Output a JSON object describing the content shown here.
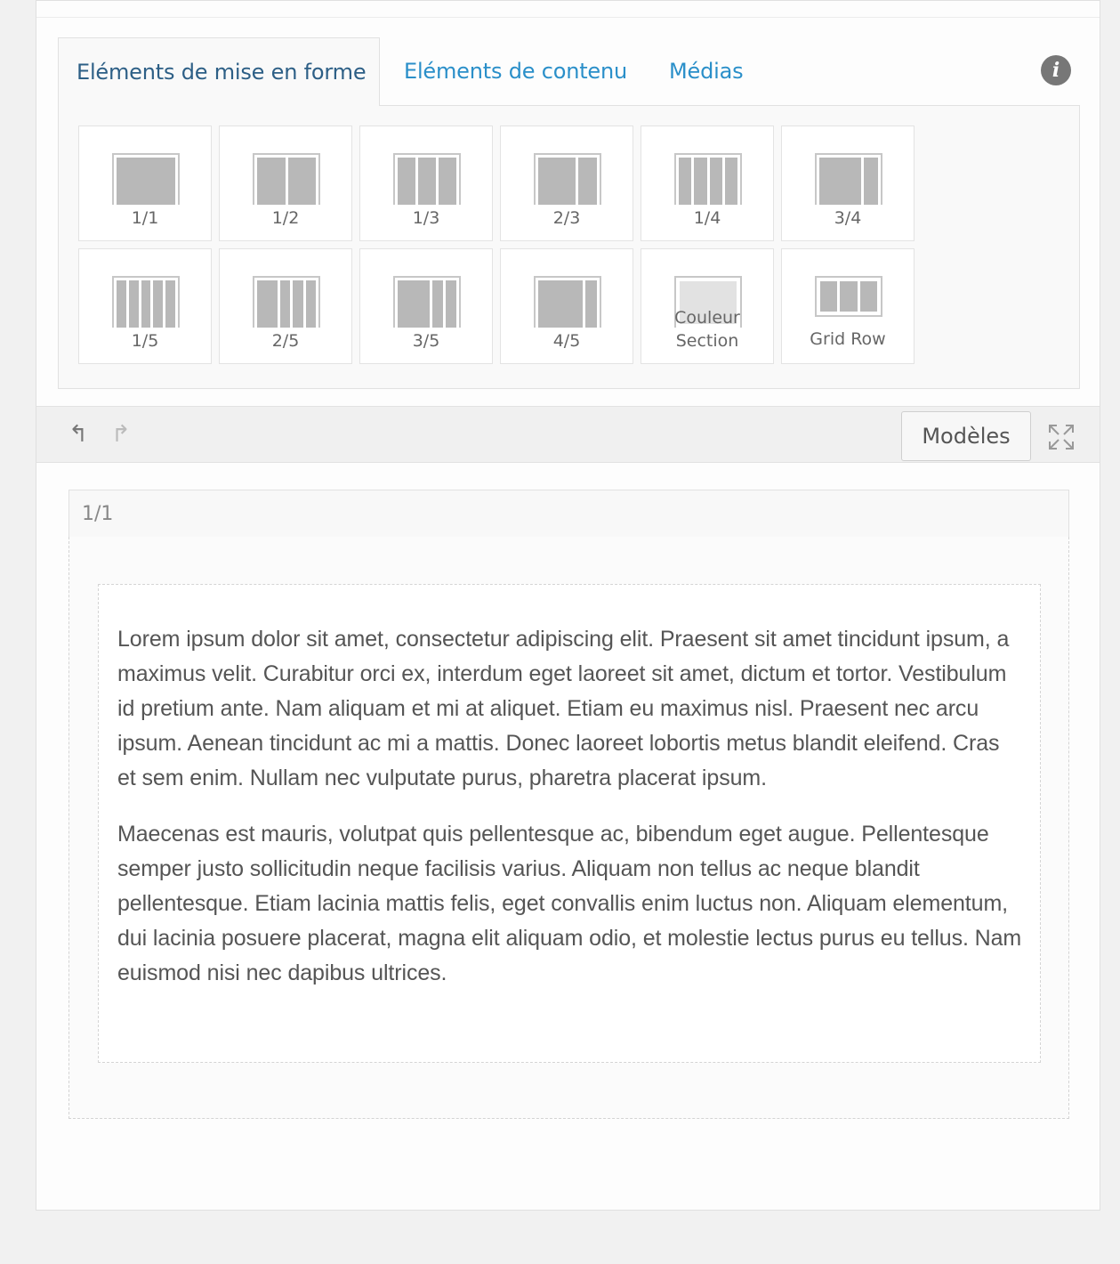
{
  "tabs": [
    {
      "label": "Eléments de mise en forme",
      "active": true
    },
    {
      "label": "Eléments de contenu",
      "active": false
    },
    {
      "label": "Médias",
      "active": false
    }
  ],
  "layouts": [
    {
      "label": "1/1",
      "cols": [
        1
      ]
    },
    {
      "label": "1/2",
      "cols": [
        1,
        1
      ]
    },
    {
      "label": "1/3",
      "cols": [
        1,
        1,
        1
      ]
    },
    {
      "label": "2/3",
      "cols": [
        2,
        1
      ]
    },
    {
      "label": "1/4",
      "cols": [
        1,
        1,
        1,
        1
      ]
    },
    {
      "label": "3/4",
      "cols": [
        3,
        1
      ]
    },
    {
      "label": "1/5",
      "cols": [
        1,
        1,
        1,
        1,
        1
      ]
    },
    {
      "label": "2/5",
      "cols": [
        2,
        1,
        1,
        1
      ]
    },
    {
      "label": "3/5",
      "cols": [
        3,
        1,
        1
      ]
    },
    {
      "label": "4/5",
      "cols": [
        4,
        1
      ]
    },
    {
      "label": "Couleur\nSection",
      "cols": [
        1
      ],
      "kind": "section"
    },
    {
      "label": "Grid Row",
      "cols": [
        1,
        1,
        1
      ],
      "kind": "gridrow"
    }
  ],
  "toolbar": {
    "models_label": "Modèles"
  },
  "editor": {
    "column_label": "1/1",
    "paragraphs": [
      "Lorem ipsum dolor sit amet, consectetur adipiscing elit. Praesent sit amet tincidunt ipsum, a maximus velit. Curabitur orci ex, interdum eget laoreet sit amet, dictum et tortor. Vestibulum id pretium ante. Nam aliquam et mi at aliquet. Etiam eu maximus nisl. Praesent nec arcu ipsum. Aenean tincidunt ac mi a mattis. Donec laoreet lobortis metus blandit eleifend. Cras et sem enim. Nullam nec vulputate purus, pharetra placerat ipsum.",
      "Maecenas est mauris, volutpat quis pellentesque ac, bibendum eget augue. Pellentesque semper justo sollicitudin neque facilisis varius. Aliquam non tellus ac neque blandit pellentesque. Etiam lacinia mattis felis, eget convallis enim luctus non. Aliquam elementum, dui lacinia posuere placerat, magna elit aliquam odio, et molestie lectus purus eu tellus. Nam euismod nisi nec dapibus ultrices."
    ]
  },
  "icons": {
    "info": "info-icon",
    "undo": "undo-icon",
    "redo": "redo-icon",
    "expand": "expand-icon"
  },
  "colors": {
    "active_tab_text": "#2d5f86",
    "tab_link": "#2a8fc9",
    "tile_fill": "#b8b8b8"
  }
}
